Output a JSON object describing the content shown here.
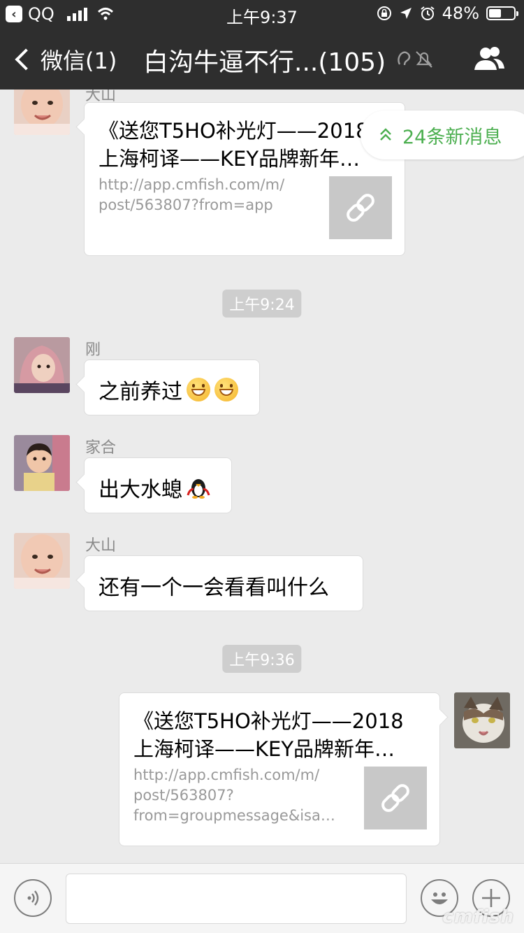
{
  "status_bar": {
    "back_app": "QQ",
    "time": "上午9:37",
    "battery": "48%"
  },
  "nav": {
    "back_label": "微信(1)",
    "title": "白沟牛逼不行...(105)"
  },
  "new_messages_banner": "24条新消息",
  "messages": {
    "m1": {
      "sender": "大山",
      "title_line1": "《送您T5HO补光灯——2018",
      "title_line2": "上海柯译——KEY品牌新年…",
      "url_line1": "http://app.cmfish.com/m/",
      "url_line2": "post/563807?from=app"
    },
    "ts1": "上午9:24",
    "m2": {
      "sender": "刚",
      "text": "之前养过"
    },
    "m3": {
      "sender": "家合",
      "text": "出大水螅"
    },
    "m4": {
      "sender": "大山",
      "text": "还有一个一会看看叫什么"
    },
    "ts2": "上午9:36",
    "m5": {
      "title_line1": "《送您T5HO补光灯——2018",
      "title_line2": "上海柯译——KEY品牌新年…",
      "url_line1": "http://app.cmfish.com/m/",
      "url_line2": "post/563807?",
      "url_line3": "from=groupmessage&isa…"
    }
  },
  "watermark": "cmfish",
  "colors": {
    "header_bg": "#2e2e2e",
    "chat_bg": "#ebebeb",
    "accent_green": "#4caf50"
  }
}
